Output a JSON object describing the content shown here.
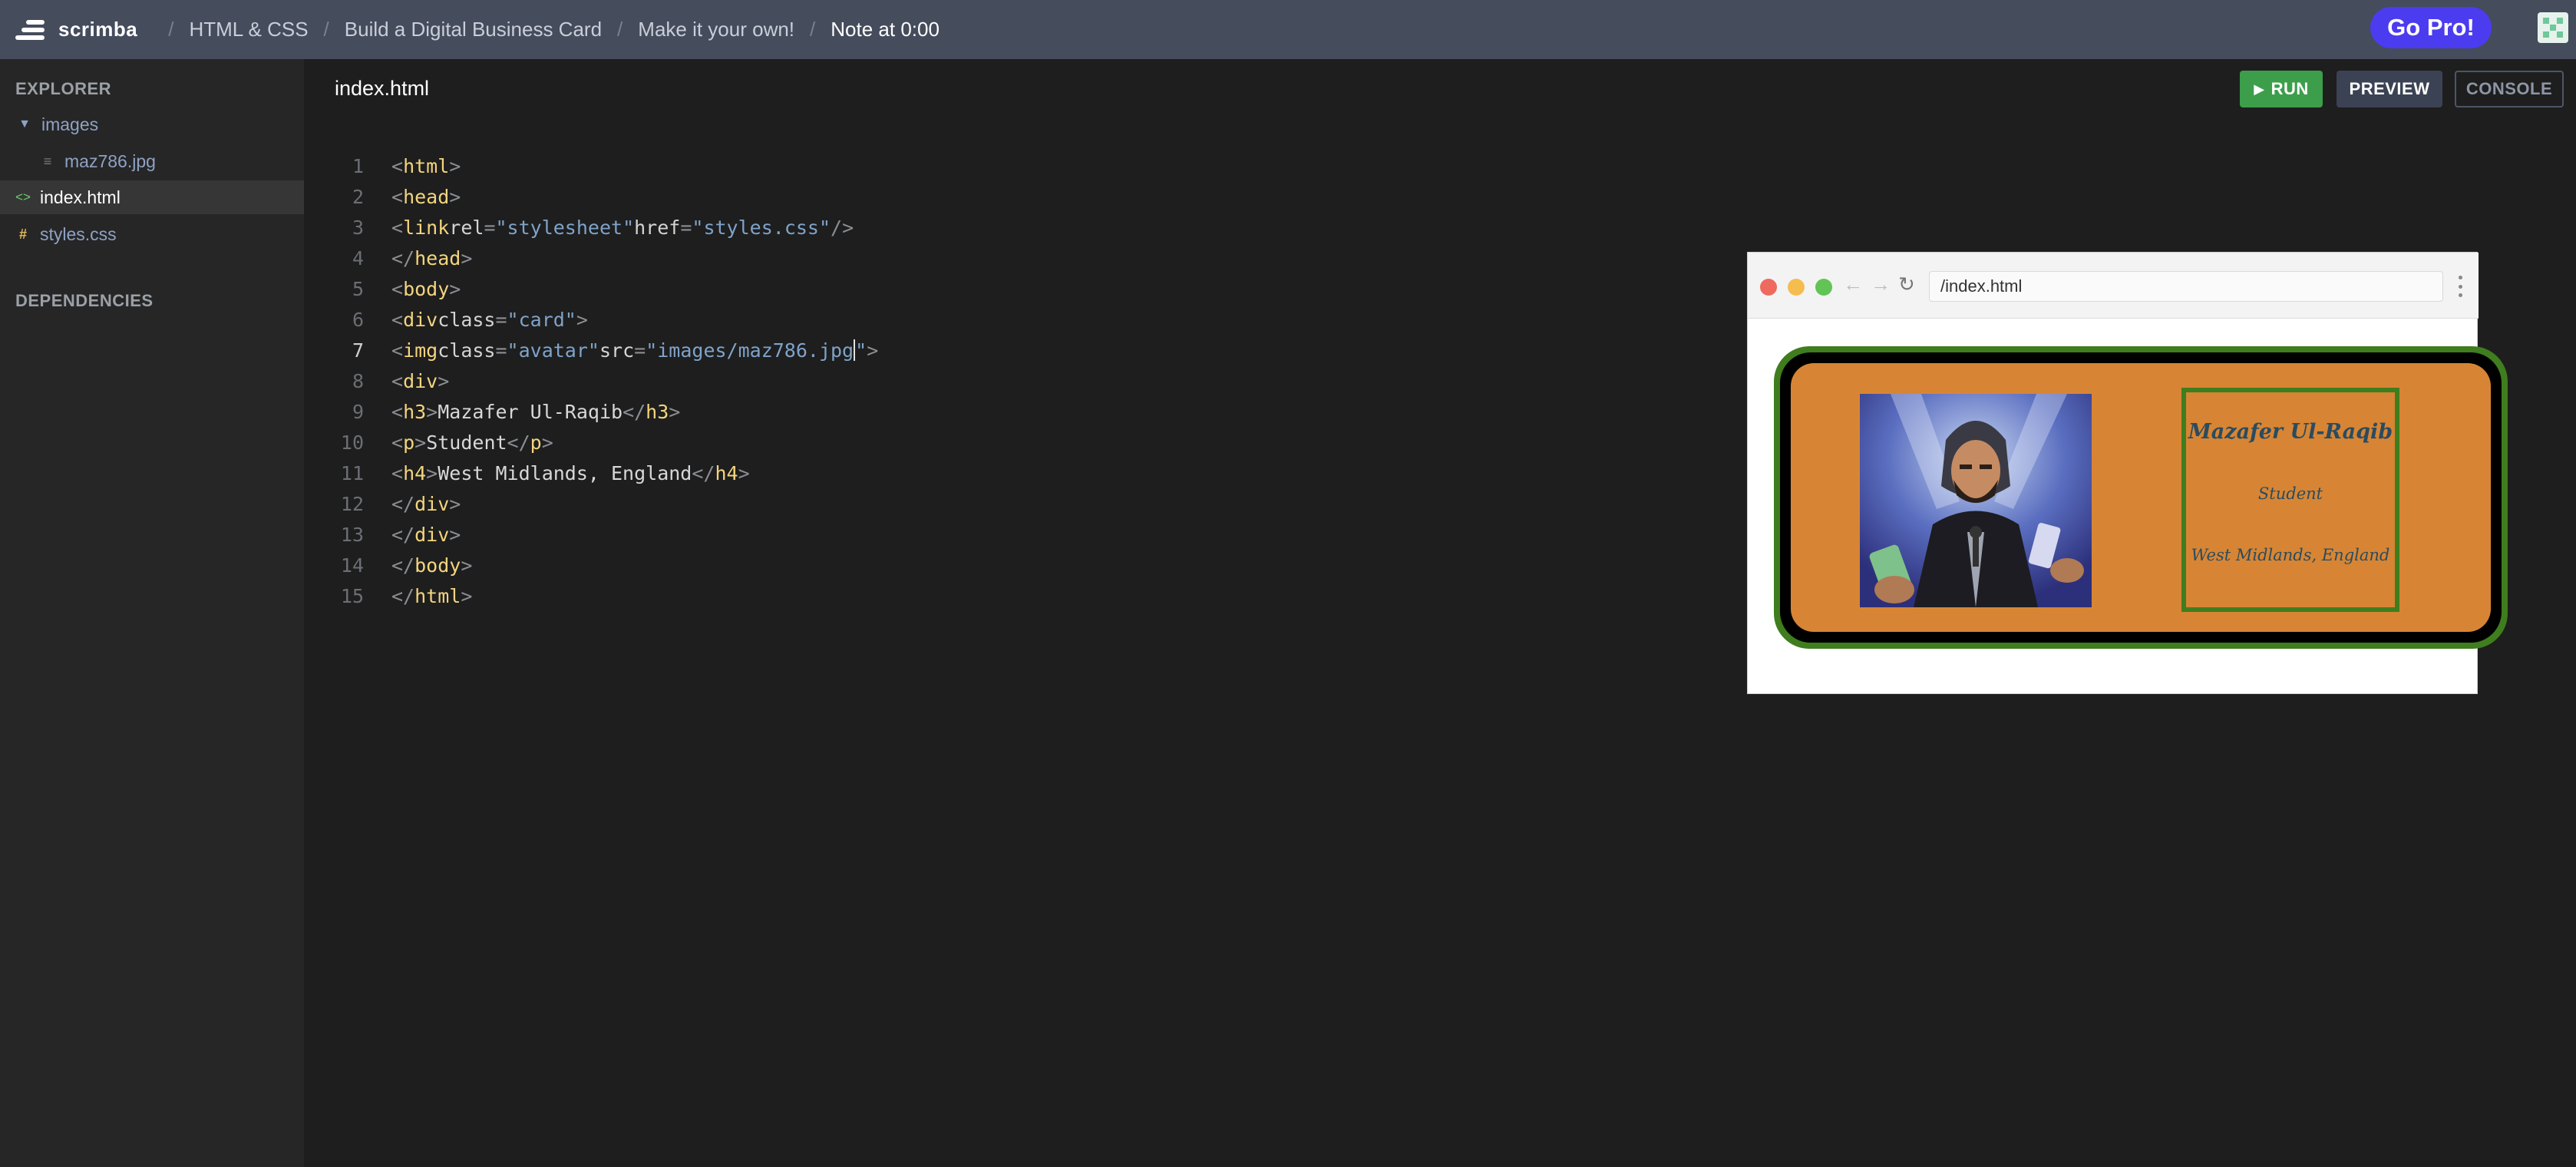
{
  "topbar": {
    "brand": "scrimba",
    "breadcrumbs": [
      "HTML & CSS",
      "Build a Digital Business Card",
      "Make it your own!"
    ],
    "current": "Note at 0:00",
    "go_pro": "Go Pro!",
    "separator": "/"
  },
  "sidebar": {
    "explorer_heading": "EXPLORER",
    "folder": "images",
    "files": {
      "image": "maz786.jpg",
      "html": "index.html",
      "css": "styles.css"
    },
    "dependencies_heading": "DEPENDENCIES"
  },
  "editor": {
    "filename": "index.html",
    "run_label": "RUN",
    "preview_label": "PREVIEW",
    "console_label": "CONSOLE",
    "active_line": 7,
    "line_numbers": [
      "1",
      "2",
      "3",
      "4",
      "5",
      "6",
      "7",
      "8",
      "9",
      "10",
      "11",
      "12",
      "13",
      "14",
      "15"
    ],
    "code": {
      "l1_tag": "html",
      "l2_tag": "head",
      "l3_tag": "link",
      "l3_attr1": "rel",
      "l3_val1": "\"stylesheet\"",
      "l3_attr2": "href",
      "l3_val2": "\"styles.css\"",
      "l4_tag": "head",
      "l5_tag": "body",
      "l6_tag": "div",
      "l6_attr": "class",
      "l6_val": "\"card\"",
      "l7_tag": "img",
      "l7_attr1": "class",
      "l7_val1": "\"avatar\"",
      "l7_attr2": "src",
      "l7_val2a": "\"images/maz786.jpg",
      "l7_val2b": "\"",
      "l8_tag": "div",
      "l9_tag": "h3",
      "l9_text": "Mazafer Ul-Raqib",
      "l10_tag": "p",
      "l10_text": "Student",
      "l11_tag": "h4",
      "l11_text": "West Midlands, England",
      "l12_tag": "div",
      "l13_tag": "div",
      "l14_tag": "body",
      "l15_tag": "html"
    }
  },
  "preview": {
    "url": "/index.html",
    "card": {
      "name": "Mazafer Ul-Raqib",
      "role": "Student",
      "location": "West Midlands, England"
    }
  },
  "colors": {
    "topbar": "#454c5c",
    "go_pro": "#4b3cf0",
    "run": "#3c9e4b",
    "card_bg": "#d78534",
    "card_border": "#3f7d1e"
  }
}
